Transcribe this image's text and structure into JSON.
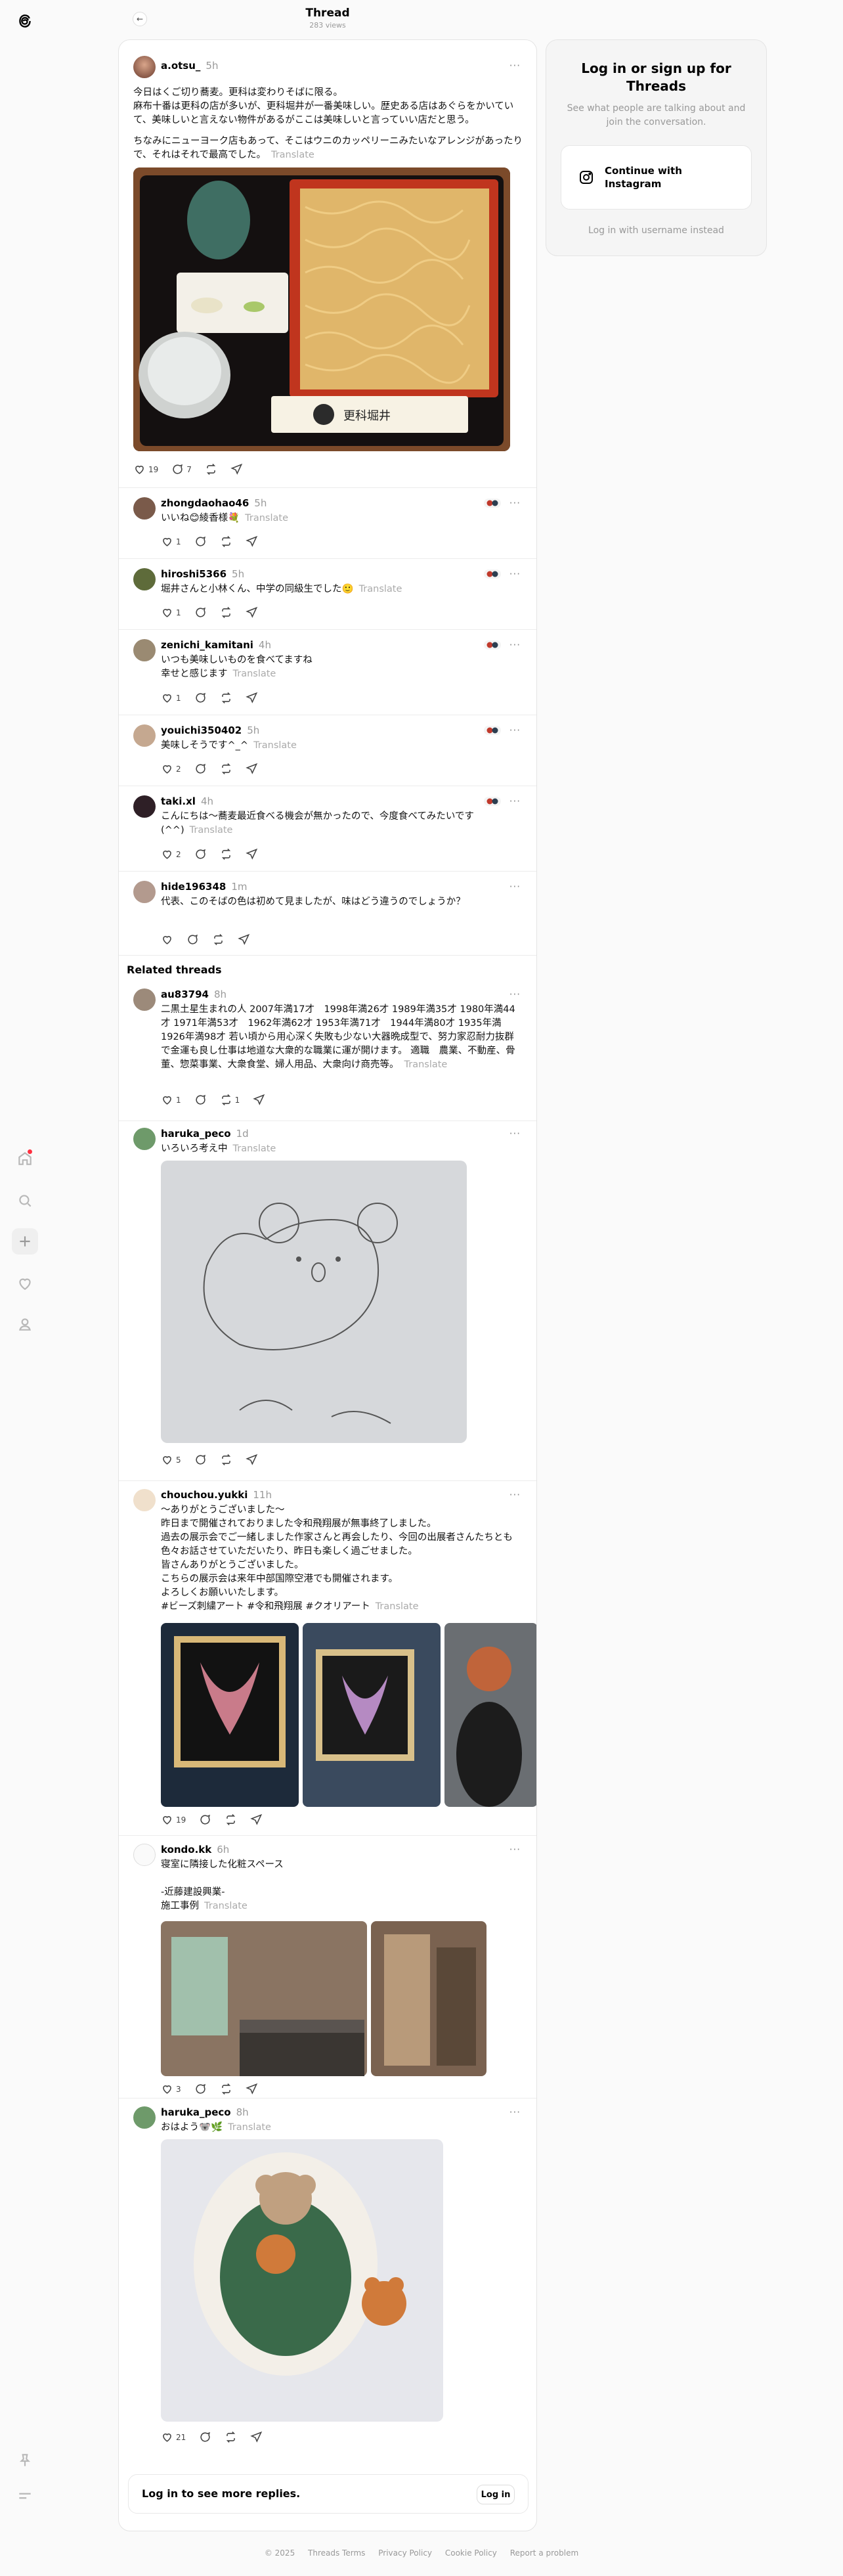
{
  "header": {
    "title": "Thread",
    "views": "283 views"
  },
  "nav": {
    "items": [
      "home-icon",
      "search-icon",
      "plus-icon",
      "heart-icon",
      "profile-icon"
    ],
    "bottom": [
      "pin-icon",
      "menu-icon"
    ]
  },
  "main_post": {
    "user": "a.otsu_",
    "time": "5h",
    "text1": "今日はくご切り蕎麦。更科は変わりそばに限る。\n麻布十番は更科の店が多いが、更科堀井が一番美味しい。歴史ある店はあぐらをかいていて、美味しいと言えない物件があるがここは美味しいと言っていい店だと思う。",
    "text2": "ちなみにニューヨーク店もあって、そこはウニのカッペリーニみたいなアレンジがあったりで、それはそれで最高でした。",
    "translate": "Translate",
    "likes": "19",
    "replies": "7",
    "sign_text": "更科堀井"
  },
  "replies": [
    {
      "user": "zhongdaohao46",
      "time": "5h",
      "text": "いいね😊綾香様💐",
      "likes": "1"
    },
    {
      "user": "hiroshi5366",
      "time": "5h",
      "text": "堀井さんと小林くん、中学の同級生でした🙂",
      "likes": "1"
    },
    {
      "user": "zenichi_kamitani",
      "time": "4h",
      "text": "いつも美味しいものを食べてますね\n幸せと感じます",
      "likes": "1"
    },
    {
      "user": "youichi350402",
      "time": "5h",
      "text": "美味しそうです^_^",
      "likes": "2"
    },
    {
      "user": "taki.xl",
      "time": "4h",
      "text": "こんにちは〜蕎麦最近食べる機会が無かったので、今度食べてみたいです\n(^^)",
      "likes": "2"
    },
    {
      "user": "hide196348",
      "time": "1m",
      "text": "代表、このそばの色は初めて見ましたが、味はどう違うのでしょうか？",
      "likes": ""
    }
  ],
  "related_title": "Related threads",
  "related": [
    {
      "user": "au83794",
      "time": "8h",
      "text": "二黒土星生まれの人 2007年満17才　1998年満26才 1989年満35才 1980年満44才 1971年満53才　1962年満62才 1953年満71才　1944年満80才 1935年満　1926年満98才 若い頃から用心深く失敗も少ない大器晩成型で、努力家忍耐力抜群で金運も良し仕事は地道な大衆的な職業に運が開けます。 適職　農業、不動産、骨董、惣菜事業、大衆食堂、婦人用品、大衆向け商売等。",
      "likes": "1",
      "reposts": "1"
    },
    {
      "user": "haruka_peco",
      "time": "1d",
      "text": "いろいろ考え中",
      "likes": "5"
    },
    {
      "user": "chouchou.yukki",
      "time": "11h",
      "text": "〜ありがとうございました〜\n昨日まで開催されておりました令和飛翔展が無事終了しました。\n過去の展示会でご一緒しました作家さんと再会したり、今回の出展者さんたちとも色々お話させていただいたり、昨日も楽しく過ごせました。\n皆さんありがとうございました。\nこちらの展示会は来年中部国際空港でも開催されます。\nよろしくお願いいたします。\n#ビーズ刺繍アート #令和飛翔展 #クオリアート",
      "likes": "19"
    },
    {
      "user": "kondo.kk",
      "time": "6h",
      "text": "寝室に隣接した化粧スペース\n\n-近藤建設興業-\n施工事例",
      "likes": "3"
    },
    {
      "user": "haruka_peco",
      "time": "8h",
      "text": "おはよう🐨🌿",
      "likes": "21"
    }
  ],
  "login_bar": {
    "message": "Log in to see more replies.",
    "button": "Log in"
  },
  "login_card": {
    "title": "Log in or sign up for Threads",
    "desc": "See what people are talking about and join the conversation.",
    "button": "Continue with Instagram",
    "alt": "Log in with username instead"
  },
  "footer": [
    "© 2025",
    "Threads Terms",
    "Privacy Policy",
    "Cookie Policy",
    "Report a problem"
  ],
  "colors": {
    "accent": "#000000",
    "muted": "#999999",
    "notification": "#ff3040"
  }
}
